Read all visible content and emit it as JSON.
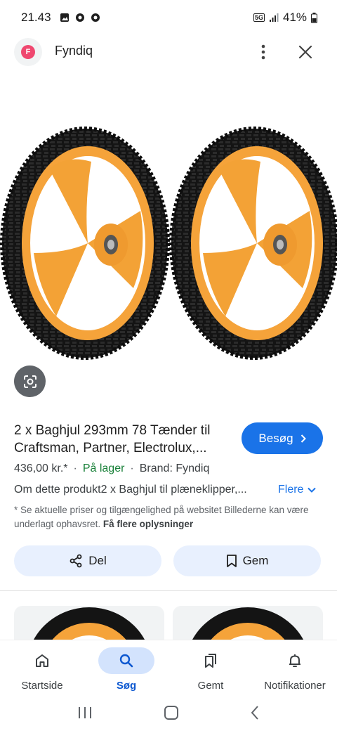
{
  "status_bar": {
    "time": "21.43",
    "network": "5G",
    "battery": "41%"
  },
  "header": {
    "site_initial": "F",
    "site_name": "Fyndiq"
  },
  "product": {
    "title": "2 x Baghjul 293mm 78 Tænder til Craftsman, Partner, Electrolux,...",
    "visit_label": "Besøg",
    "price": "436,00 kr.*",
    "stock": "På lager",
    "brand": "Brand: Fyndiq",
    "description": "Om dette produkt2 x Baghjul til plæneklipper,...",
    "more_label": "Flere",
    "disclaimer": "* Se aktuelle priser og tilgængelighed på websitet Billederne kan være underlagt ophavsret.",
    "disclaimer_link": "Få flere oplysninger",
    "share_label": "Del",
    "save_label": "Gem"
  },
  "bottom_nav": {
    "items": [
      {
        "label": "Startside",
        "icon": "home-icon"
      },
      {
        "label": "Søg",
        "icon": "search-icon"
      },
      {
        "label": "Gemt",
        "icon": "bookmarks-icon"
      },
      {
        "label": "Notifikationer",
        "icon": "bell-icon"
      }
    ],
    "active": "Søg"
  },
  "colors": {
    "accent": "#1a73e8",
    "stock_green": "#188038",
    "wheel_orange": "#f5a33a",
    "tire_black": "#161616"
  }
}
